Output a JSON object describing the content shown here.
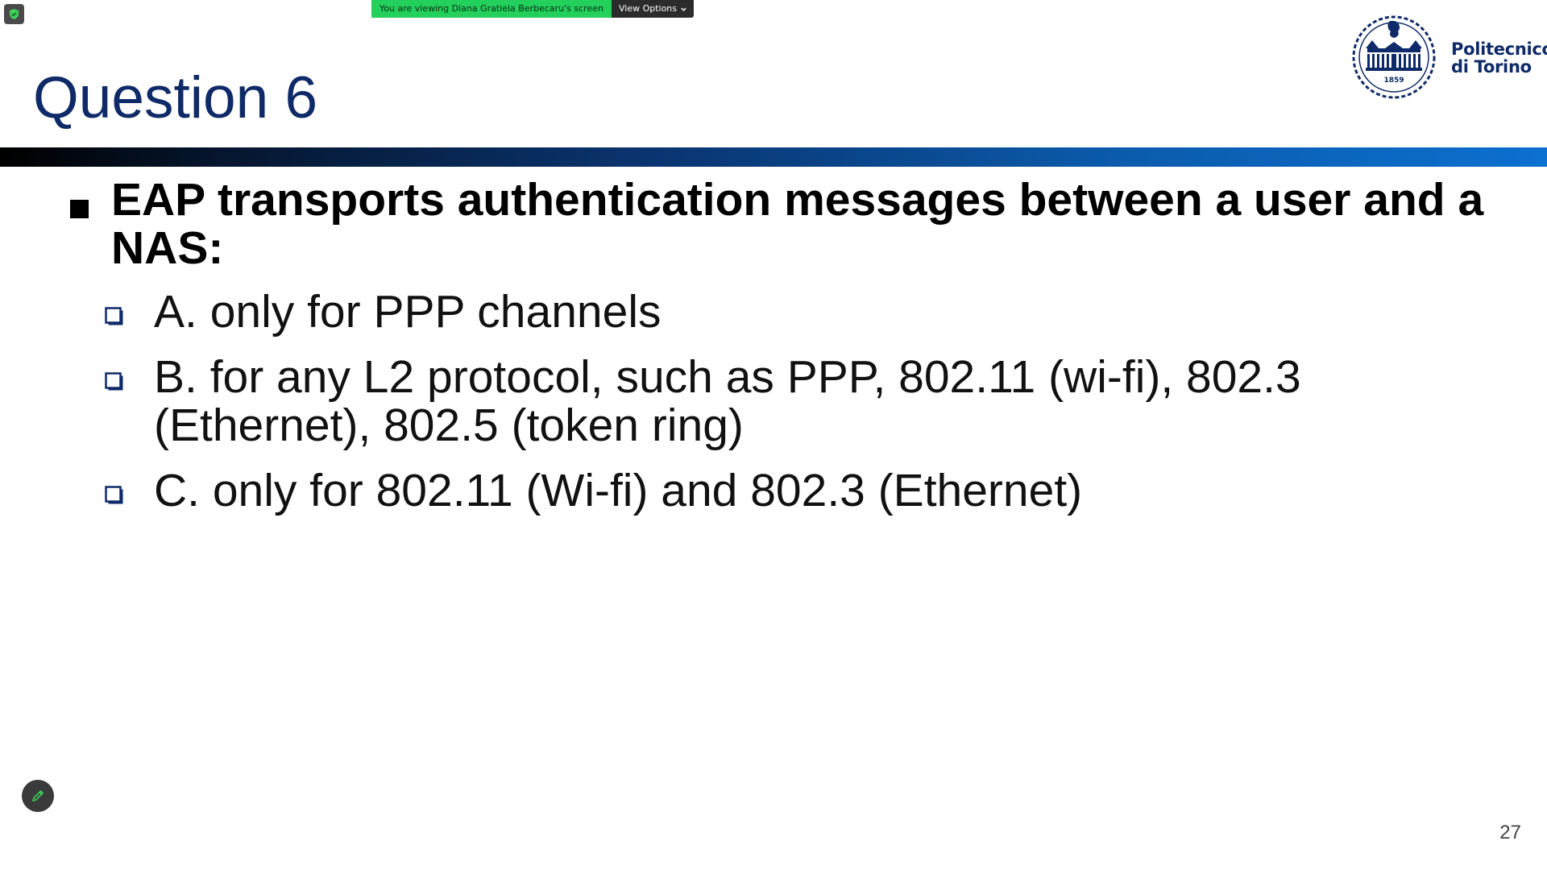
{
  "zoom": {
    "viewing_banner": "You are viewing Diana Gratiela Berbecaru's screen",
    "view_options_label": "View Options",
    "shield_icon": "shield-check-icon",
    "annotate_icon": "pencil-icon",
    "colors": {
      "banner_green": "#23d05c",
      "banner_dark": "#2b2b2b",
      "shield_green": "#3fcf5a"
    }
  },
  "slide": {
    "title": "Question 6",
    "logo": {
      "line1": "Politecnico",
      "line2": "di Torino",
      "year": "1859"
    },
    "question": "EAP transports authentication messages between a user and a NAS:",
    "options": [
      {
        "text": "A. only for PPP channels"
      },
      {
        "text": "B. for any L2 protocol, such as PPP, 802.11 (wi-fi), 802.3 (Ethernet), 802.5 (token ring)"
      },
      {
        "text": "C. only for 802.11 (Wi-fi) and 802.3 (Ethernet)"
      }
    ],
    "page_number": "27",
    "colors": {
      "title": "#0f2a68",
      "checkbox": "#0f2a68",
      "bar_start": "#000000",
      "bar_end": "#0c70cf"
    }
  }
}
